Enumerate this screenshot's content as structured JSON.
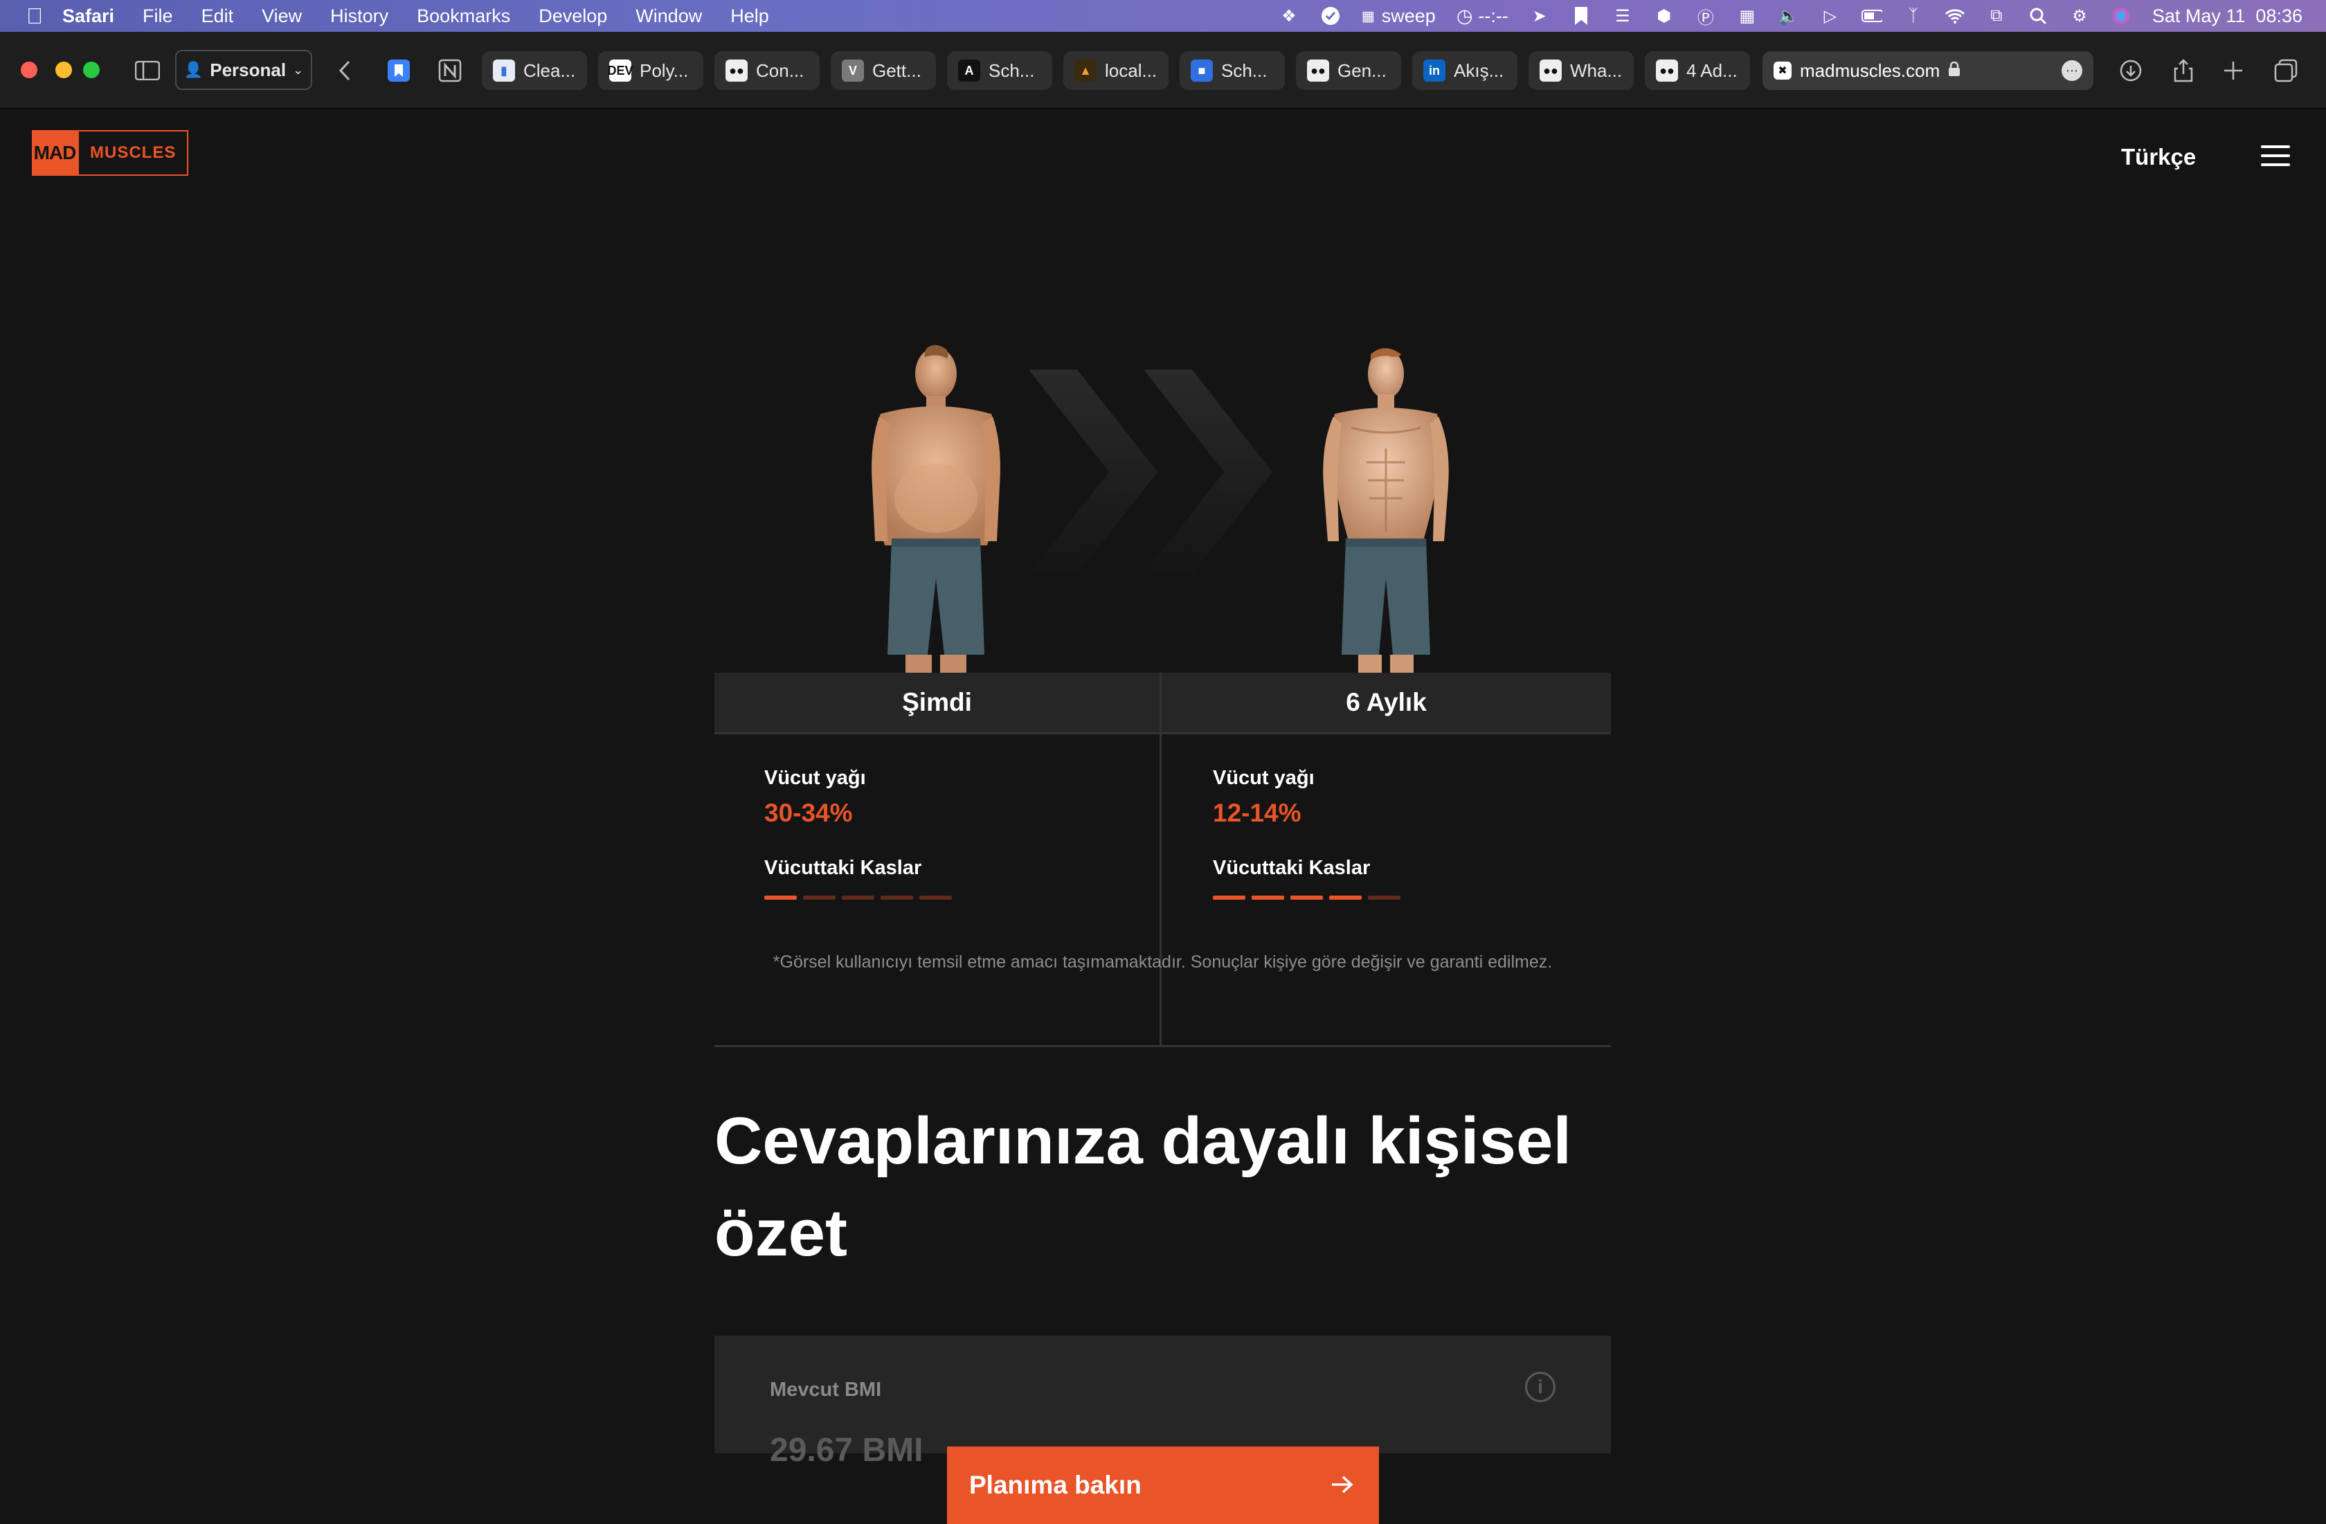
{
  "menubar": {
    "app": "Safari",
    "items": [
      "File",
      "Edit",
      "View",
      "History",
      "Bookmarks",
      "Develop",
      "Window",
      "Help"
    ],
    "status_sweep": "sweep",
    "status_timer": "--:--",
    "datetime": "Sat May 11  08:36"
  },
  "toolbar": {
    "profile": "Personal",
    "tabs": [
      {
        "label": "Clea...",
        "icon": "doc-icon"
      },
      {
        "label": "Poly...",
        "icon": "dev-icon"
      },
      {
        "label": "Con...",
        "icon": "medium-icon"
      },
      {
        "label": "Gett...",
        "icon": "v-icon"
      },
      {
        "label": "Sch...",
        "icon": "a-icon"
      },
      {
        "label": "local...",
        "icon": "ship-icon"
      },
      {
        "label": "Sch...",
        "icon": "puzzle-icon"
      },
      {
        "label": "Gen...",
        "icon": "medium-icon"
      },
      {
        "label": "Akış...",
        "icon": "linkedin-icon"
      },
      {
        "label": "Wha...",
        "icon": "medium-icon"
      },
      {
        "label": "4 Ad...",
        "icon": "medium-icon"
      }
    ],
    "active_tab": {
      "label": "madmuscles.com"
    }
  },
  "page": {
    "logo_left": "MAD",
    "logo_right": "MUSCLES",
    "language": "Türkçe",
    "now_title": "Şimdi",
    "future_title": "6 Aylık",
    "now": {
      "body_fat_label": "Vücut yağı",
      "body_fat_value": "30-34%",
      "muscle_label": "Vücuttaki Kaslar",
      "muscle_level": 1,
      "muscle_max": 5
    },
    "future": {
      "body_fat_label": "Vücut yağı",
      "body_fat_value": "12-14%",
      "muscle_label": "Vücuttaki Kaslar",
      "muscle_level": 4,
      "muscle_max": 5
    },
    "disclaimer": "*Görsel kullanıcıyı temsil etme amacı taşımamaktadır. Sonuçlar kişiye göre değişir ve garanti edilmez.",
    "heading": "Cevaplarınıza dayalı kişisel özet",
    "bmi_label": "Mevcut BMI",
    "bmi_value": "29.67 BMI",
    "cta_label": "Planıma bakın",
    "accent": "#e95428"
  }
}
